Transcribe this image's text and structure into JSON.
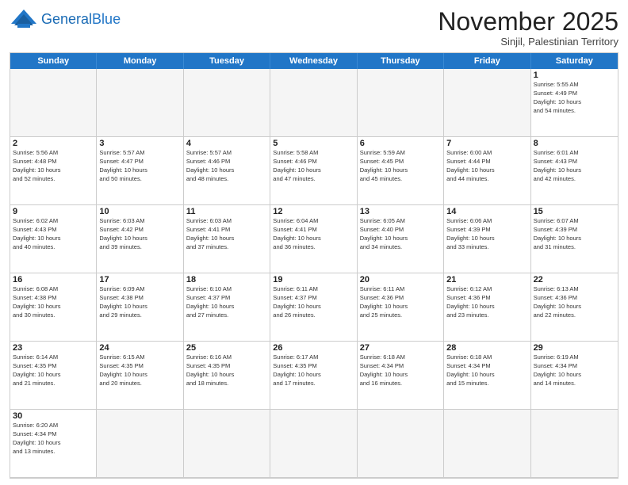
{
  "header": {
    "logo_general": "General",
    "logo_blue": "Blue",
    "month_title": "November 2025",
    "subtitle": "Sinjil, Palestinian Territory"
  },
  "days": [
    "Sunday",
    "Monday",
    "Tuesday",
    "Wednesday",
    "Thursday",
    "Friday",
    "Saturday"
  ],
  "cells": [
    {
      "num": "",
      "info": "",
      "empty": true
    },
    {
      "num": "",
      "info": "",
      "empty": true
    },
    {
      "num": "",
      "info": "",
      "empty": true
    },
    {
      "num": "",
      "info": "",
      "empty": true
    },
    {
      "num": "",
      "info": "",
      "empty": true
    },
    {
      "num": "",
      "info": "",
      "empty": true
    },
    {
      "num": "1",
      "info": "Sunrise: 5:55 AM\nSunset: 4:49 PM\nDaylight: 10 hours\nand 54 minutes."
    },
    {
      "num": "2",
      "info": "Sunrise: 5:56 AM\nSunset: 4:48 PM\nDaylight: 10 hours\nand 52 minutes."
    },
    {
      "num": "3",
      "info": "Sunrise: 5:57 AM\nSunset: 4:47 PM\nDaylight: 10 hours\nand 50 minutes."
    },
    {
      "num": "4",
      "info": "Sunrise: 5:57 AM\nSunset: 4:46 PM\nDaylight: 10 hours\nand 48 minutes."
    },
    {
      "num": "5",
      "info": "Sunrise: 5:58 AM\nSunset: 4:46 PM\nDaylight: 10 hours\nand 47 minutes."
    },
    {
      "num": "6",
      "info": "Sunrise: 5:59 AM\nSunset: 4:45 PM\nDaylight: 10 hours\nand 45 minutes."
    },
    {
      "num": "7",
      "info": "Sunrise: 6:00 AM\nSunset: 4:44 PM\nDaylight: 10 hours\nand 44 minutes."
    },
    {
      "num": "8",
      "info": "Sunrise: 6:01 AM\nSunset: 4:43 PM\nDaylight: 10 hours\nand 42 minutes."
    },
    {
      "num": "9",
      "info": "Sunrise: 6:02 AM\nSunset: 4:43 PM\nDaylight: 10 hours\nand 40 minutes."
    },
    {
      "num": "10",
      "info": "Sunrise: 6:03 AM\nSunset: 4:42 PM\nDaylight: 10 hours\nand 39 minutes."
    },
    {
      "num": "11",
      "info": "Sunrise: 6:03 AM\nSunset: 4:41 PM\nDaylight: 10 hours\nand 37 minutes."
    },
    {
      "num": "12",
      "info": "Sunrise: 6:04 AM\nSunset: 4:41 PM\nDaylight: 10 hours\nand 36 minutes."
    },
    {
      "num": "13",
      "info": "Sunrise: 6:05 AM\nSunset: 4:40 PM\nDaylight: 10 hours\nand 34 minutes."
    },
    {
      "num": "14",
      "info": "Sunrise: 6:06 AM\nSunset: 4:39 PM\nDaylight: 10 hours\nand 33 minutes."
    },
    {
      "num": "15",
      "info": "Sunrise: 6:07 AM\nSunset: 4:39 PM\nDaylight: 10 hours\nand 31 minutes."
    },
    {
      "num": "16",
      "info": "Sunrise: 6:08 AM\nSunset: 4:38 PM\nDaylight: 10 hours\nand 30 minutes."
    },
    {
      "num": "17",
      "info": "Sunrise: 6:09 AM\nSunset: 4:38 PM\nDaylight: 10 hours\nand 29 minutes."
    },
    {
      "num": "18",
      "info": "Sunrise: 6:10 AM\nSunset: 4:37 PM\nDaylight: 10 hours\nand 27 minutes."
    },
    {
      "num": "19",
      "info": "Sunrise: 6:11 AM\nSunset: 4:37 PM\nDaylight: 10 hours\nand 26 minutes."
    },
    {
      "num": "20",
      "info": "Sunrise: 6:11 AM\nSunset: 4:36 PM\nDaylight: 10 hours\nand 25 minutes."
    },
    {
      "num": "21",
      "info": "Sunrise: 6:12 AM\nSunset: 4:36 PM\nDaylight: 10 hours\nand 23 minutes."
    },
    {
      "num": "22",
      "info": "Sunrise: 6:13 AM\nSunset: 4:36 PM\nDaylight: 10 hours\nand 22 minutes."
    },
    {
      "num": "23",
      "info": "Sunrise: 6:14 AM\nSunset: 4:35 PM\nDaylight: 10 hours\nand 21 minutes."
    },
    {
      "num": "24",
      "info": "Sunrise: 6:15 AM\nSunset: 4:35 PM\nDaylight: 10 hours\nand 20 minutes."
    },
    {
      "num": "25",
      "info": "Sunrise: 6:16 AM\nSunset: 4:35 PM\nDaylight: 10 hours\nand 18 minutes."
    },
    {
      "num": "26",
      "info": "Sunrise: 6:17 AM\nSunset: 4:35 PM\nDaylight: 10 hours\nand 17 minutes."
    },
    {
      "num": "27",
      "info": "Sunrise: 6:18 AM\nSunset: 4:34 PM\nDaylight: 10 hours\nand 16 minutes."
    },
    {
      "num": "28",
      "info": "Sunrise: 6:18 AM\nSunset: 4:34 PM\nDaylight: 10 hours\nand 15 minutes."
    },
    {
      "num": "29",
      "info": "Sunrise: 6:19 AM\nSunset: 4:34 PM\nDaylight: 10 hours\nand 14 minutes."
    },
    {
      "num": "30",
      "info": "Sunrise: 6:20 AM\nSunset: 4:34 PM\nDaylight: 10 hours\nand 13 minutes."
    },
    {
      "num": "",
      "info": "",
      "empty": true
    },
    {
      "num": "",
      "info": "",
      "empty": true
    },
    {
      "num": "",
      "info": "",
      "empty": true
    },
    {
      "num": "",
      "info": "",
      "empty": true
    },
    {
      "num": "",
      "info": "",
      "empty": true
    },
    {
      "num": "",
      "info": "",
      "empty": true
    }
  ]
}
